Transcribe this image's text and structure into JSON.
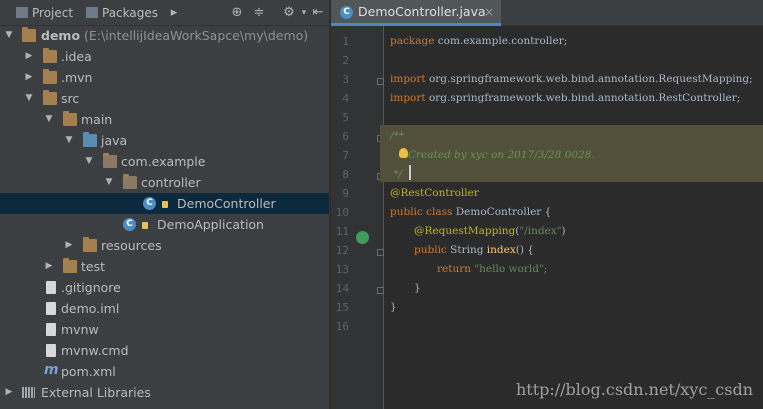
{
  "project_panel": {
    "tabs": [
      {
        "label": "Project"
      },
      {
        "label": "Packages"
      }
    ],
    "tree": [
      {
        "label": "demo",
        "path": "(E:\\intellijIdeaWorkSapce\\my\\demo)"
      },
      {
        "label": ".idea"
      },
      {
        "label": ".mvn"
      },
      {
        "label": "src"
      },
      {
        "label": "main"
      },
      {
        "label": "java"
      },
      {
        "label": "com.example"
      },
      {
        "label": "controller"
      },
      {
        "label": "DemoController"
      },
      {
        "label": "DemoApplication"
      },
      {
        "label": "resources"
      },
      {
        "label": "test"
      },
      {
        "label": ".gitignore"
      },
      {
        "label": "demo.iml"
      },
      {
        "label": "mvnw"
      },
      {
        "label": "mvnw.cmd"
      },
      {
        "label": "pom.xml"
      },
      {
        "label": "External Libraries"
      }
    ]
  },
  "editor": {
    "tab": {
      "label": "DemoController.java",
      "close": "×"
    },
    "line_numbers": [
      "1",
      "2",
      "3",
      "4",
      "5",
      "6",
      "7",
      "8",
      "9",
      "10",
      "11",
      "12",
      "13",
      "14",
      "15",
      "16"
    ],
    "code": {
      "l1_kw": "package",
      "l1_rest": " com.example.controller;",
      "l3_kw": "import",
      "l3_rest": " org.springframework.web.bind.annotation.RequestMapping;",
      "l4_kw": "import",
      "l4_rest": " org.springframework.web.bind.annotation.RestController;",
      "l6": "/**",
      "l7": "Created by xyc on 2017/3/28 0028.",
      "l8": " */",
      "l9": "@RestController",
      "l10_kw": "public class",
      "l10_rest": " DemoController {",
      "l11_an": "@RequestMapping",
      "l11_p1": "(",
      "l11_st": "\"/index\"",
      "l11_p2": ")",
      "l12_kw": "public",
      "l12_t": " String ",
      "l12_fn": "index",
      "l12_rest": "() {",
      "l13_kw": "return",
      "l13_st": " \"hello world\"",
      "l13_rest": ";",
      "l14": "}",
      "l15": "}"
    }
  },
  "watermark": "http://blog.csdn.net/xyc_csdn"
}
